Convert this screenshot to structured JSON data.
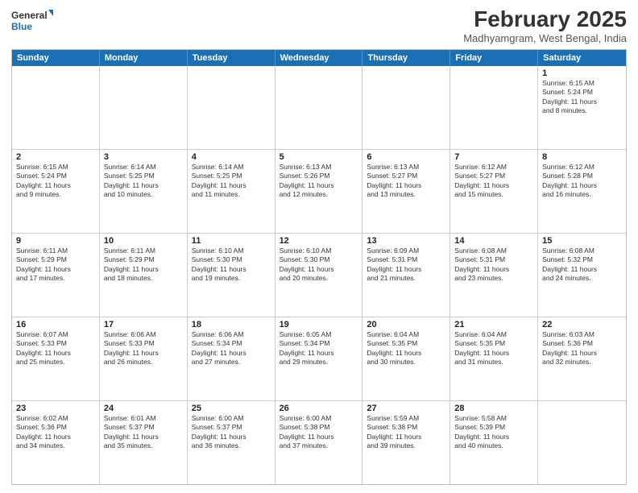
{
  "header": {
    "logo_line1": "General",
    "logo_line2": "Blue",
    "month_title": "February 2025",
    "location": "Madhyamgram, West Bengal, India"
  },
  "day_headers": [
    "Sunday",
    "Monday",
    "Tuesday",
    "Wednesday",
    "Thursday",
    "Friday",
    "Saturday"
  ],
  "weeks": [
    [
      {
        "num": "",
        "info": ""
      },
      {
        "num": "",
        "info": ""
      },
      {
        "num": "",
        "info": ""
      },
      {
        "num": "",
        "info": ""
      },
      {
        "num": "",
        "info": ""
      },
      {
        "num": "",
        "info": ""
      },
      {
        "num": "1",
        "info": "Sunrise: 6:15 AM\nSunset: 5:24 PM\nDaylight: 11 hours\nand 8 minutes."
      }
    ],
    [
      {
        "num": "2",
        "info": "Sunrise: 6:15 AM\nSunset: 5:24 PM\nDaylight: 11 hours\nand 9 minutes."
      },
      {
        "num": "3",
        "info": "Sunrise: 6:14 AM\nSunset: 5:25 PM\nDaylight: 11 hours\nand 10 minutes."
      },
      {
        "num": "4",
        "info": "Sunrise: 6:14 AM\nSunset: 5:25 PM\nDaylight: 11 hours\nand 11 minutes."
      },
      {
        "num": "5",
        "info": "Sunrise: 6:13 AM\nSunset: 5:26 PM\nDaylight: 11 hours\nand 12 minutes."
      },
      {
        "num": "6",
        "info": "Sunrise: 6:13 AM\nSunset: 5:27 PM\nDaylight: 11 hours\nand 13 minutes."
      },
      {
        "num": "7",
        "info": "Sunrise: 6:12 AM\nSunset: 5:27 PM\nDaylight: 11 hours\nand 15 minutes."
      },
      {
        "num": "8",
        "info": "Sunrise: 6:12 AM\nSunset: 5:28 PM\nDaylight: 11 hours\nand 16 minutes."
      }
    ],
    [
      {
        "num": "9",
        "info": "Sunrise: 6:11 AM\nSunset: 5:29 PM\nDaylight: 11 hours\nand 17 minutes."
      },
      {
        "num": "10",
        "info": "Sunrise: 6:11 AM\nSunset: 5:29 PM\nDaylight: 11 hours\nand 18 minutes."
      },
      {
        "num": "11",
        "info": "Sunrise: 6:10 AM\nSunset: 5:30 PM\nDaylight: 11 hours\nand 19 minutes."
      },
      {
        "num": "12",
        "info": "Sunrise: 6:10 AM\nSunset: 5:30 PM\nDaylight: 11 hours\nand 20 minutes."
      },
      {
        "num": "13",
        "info": "Sunrise: 6:09 AM\nSunset: 5:31 PM\nDaylight: 11 hours\nand 21 minutes."
      },
      {
        "num": "14",
        "info": "Sunrise: 6:08 AM\nSunset: 5:31 PM\nDaylight: 11 hours\nand 23 minutes."
      },
      {
        "num": "15",
        "info": "Sunrise: 6:08 AM\nSunset: 5:32 PM\nDaylight: 11 hours\nand 24 minutes."
      }
    ],
    [
      {
        "num": "16",
        "info": "Sunrise: 6:07 AM\nSunset: 5:33 PM\nDaylight: 11 hours\nand 25 minutes."
      },
      {
        "num": "17",
        "info": "Sunrise: 6:06 AM\nSunset: 5:33 PM\nDaylight: 11 hours\nand 26 minutes."
      },
      {
        "num": "18",
        "info": "Sunrise: 6:06 AM\nSunset: 5:34 PM\nDaylight: 11 hours\nand 27 minutes."
      },
      {
        "num": "19",
        "info": "Sunrise: 6:05 AM\nSunset: 5:34 PM\nDaylight: 11 hours\nand 29 minutes."
      },
      {
        "num": "20",
        "info": "Sunrise: 6:04 AM\nSunset: 5:35 PM\nDaylight: 11 hours\nand 30 minutes."
      },
      {
        "num": "21",
        "info": "Sunrise: 6:04 AM\nSunset: 5:35 PM\nDaylight: 11 hours\nand 31 minutes."
      },
      {
        "num": "22",
        "info": "Sunrise: 6:03 AM\nSunset: 5:36 PM\nDaylight: 11 hours\nand 32 minutes."
      }
    ],
    [
      {
        "num": "23",
        "info": "Sunrise: 6:02 AM\nSunset: 5:36 PM\nDaylight: 11 hours\nand 34 minutes."
      },
      {
        "num": "24",
        "info": "Sunrise: 6:01 AM\nSunset: 5:37 PM\nDaylight: 11 hours\nand 35 minutes."
      },
      {
        "num": "25",
        "info": "Sunrise: 6:00 AM\nSunset: 5:37 PM\nDaylight: 11 hours\nand 36 minutes."
      },
      {
        "num": "26",
        "info": "Sunrise: 6:00 AM\nSunset: 5:38 PM\nDaylight: 11 hours\nand 37 minutes."
      },
      {
        "num": "27",
        "info": "Sunrise: 5:59 AM\nSunset: 5:38 PM\nDaylight: 11 hours\nand 39 minutes."
      },
      {
        "num": "28",
        "info": "Sunrise: 5:58 AM\nSunset: 5:39 PM\nDaylight: 11 hours\nand 40 minutes."
      },
      {
        "num": "",
        "info": ""
      }
    ]
  ]
}
